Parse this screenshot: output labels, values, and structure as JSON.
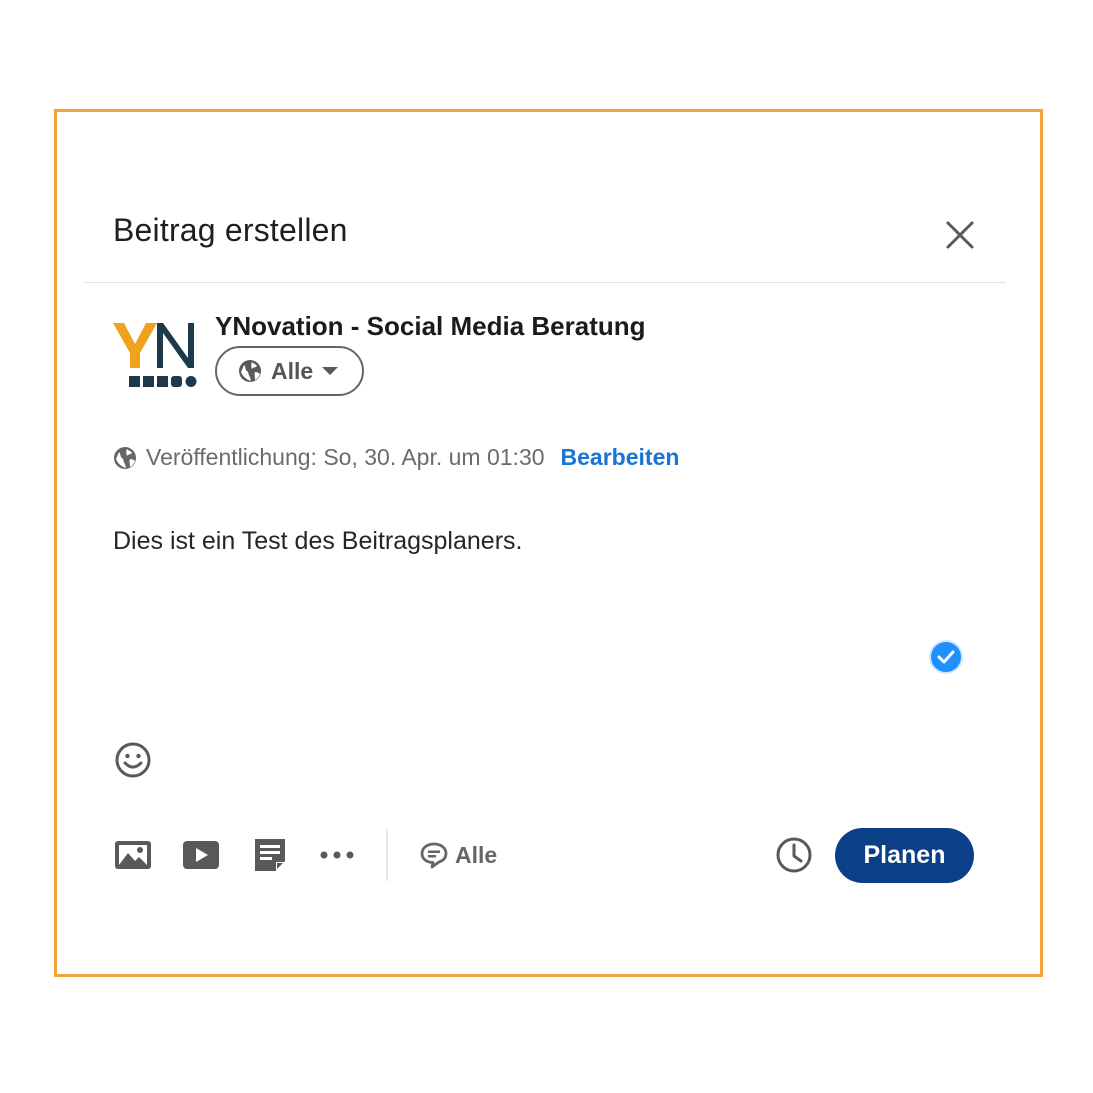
{
  "dialog": {
    "title": "Beitrag erstellen"
  },
  "author": {
    "name": "YNovation - Social Media Beratung",
    "logo_text": "YN",
    "audience_label": "Alle"
  },
  "schedule": {
    "text": "Veröffentlichung: So, 30. Apr. um 01:30",
    "edit_label": "Bearbeiten"
  },
  "post": {
    "text": "Dies ist ein Test des Beitragsplaners."
  },
  "toolbar": {
    "comment_audience_label": "Alle",
    "plan_label": "Planen"
  },
  "icons": {
    "close": "close-icon",
    "globe": "globe-icon",
    "caret": "caret-down-icon",
    "check": "check-badge-icon",
    "emoji": "emoji-icon",
    "photo": "photo-icon",
    "video": "video-icon",
    "document": "document-icon",
    "more": "more-icon",
    "comment": "comment-icon",
    "clock": "clock-icon"
  },
  "colors": {
    "frame_border": "#f3a43a",
    "primary_button": "#0b3f88",
    "link": "#1a73d6",
    "check_badge": "#1e90ff",
    "logo_orange": "#f0a21f",
    "logo_navy": "#1d3a4a"
  }
}
